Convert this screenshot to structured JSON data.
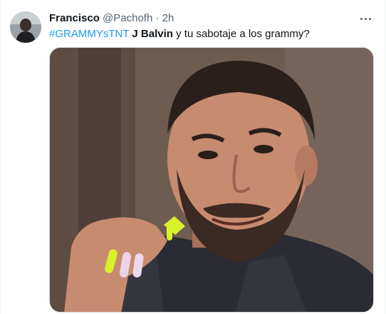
{
  "tweet": {
    "author_name": "Francisco",
    "handle": "@Pachofh",
    "separator": "·",
    "time": "2h",
    "hashtag": "#GRAMMYsTNT",
    "mention_bold": "J Balvin",
    "body_text": "y tu sabotaje a los grammy?"
  },
  "icons": {
    "more": "more-horizontal-icon",
    "avatar": "profile-avatar"
  },
  "colors": {
    "link": "#1d9bf0",
    "secondary_text": "#536471",
    "primary_text": "#0f1419",
    "border": "#cfd9de"
  }
}
